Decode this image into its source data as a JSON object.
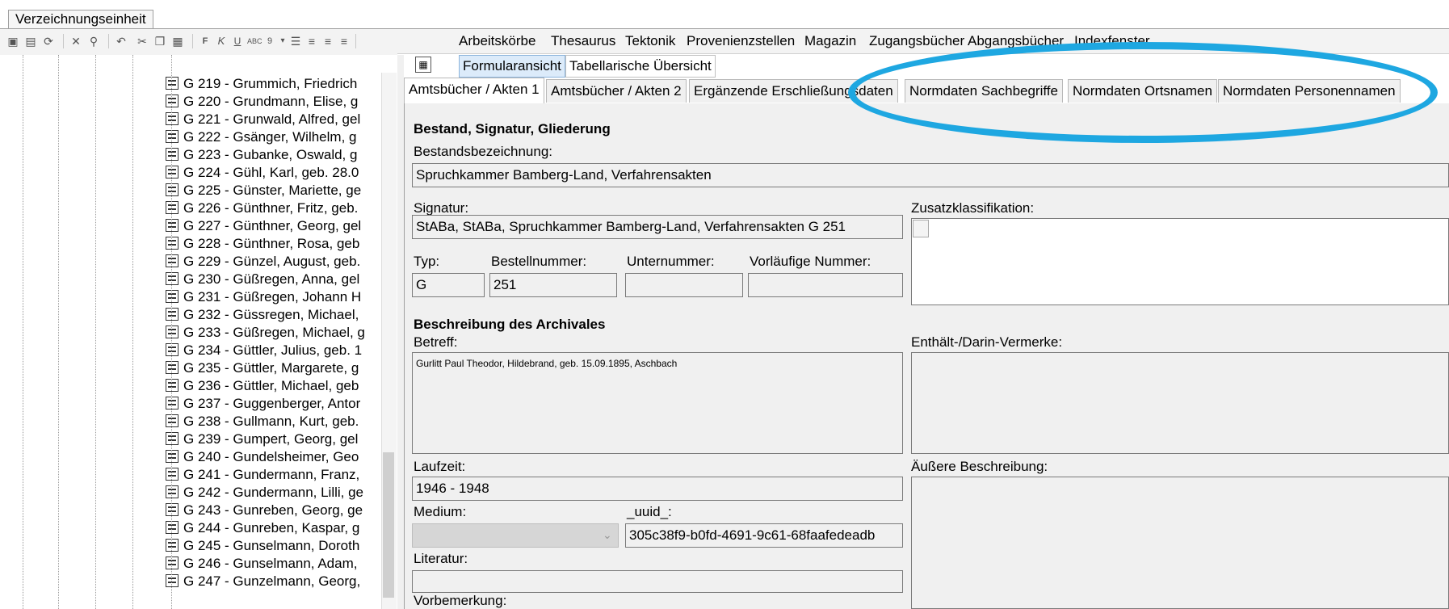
{
  "window_tab": "Verzeichnungseinheit",
  "menu": [
    "Arbeitskörbe",
    "Thesaurus",
    "Tektonik",
    "Provenienzstellen",
    "Magazin",
    "Zugangsbücher",
    "Abgangsbücher",
    "Indexfenster"
  ],
  "view_tabs": [
    "Formularansicht",
    "Tabellarische Übersicht"
  ],
  "form_tabs": [
    "Amtsbücher / Akten 1",
    "Amtsbücher / Akten 2",
    "Ergänzende Erschließungsdaten",
    "Normdaten Sachbegriffe",
    "Normdaten Ortsnamen",
    "Normdaten Personennamen"
  ],
  "tree": [
    "G 219 - Grummich, Friedrich",
    "G 220 - Grundmann, Elise, g",
    "G 221 - Grunwald, Alfred, gel",
    "G 222 - Gsänger, Wilhelm, g",
    "G 223 - Gubanke, Oswald, g",
    "G 224 - Gühl, Karl, geb. 28.0",
    "G 225 - Günster, Mariette, ge",
    "G 226 - Günthner, Fritz, geb.",
    "G 227 - Günthner, Georg, gel",
    "G 228 - Günthner, Rosa, geb",
    "G 229 - Günzel, August, geb.",
    "G 230 - Güßregen, Anna, gel",
    "G 231 - Güßregen, Johann H",
    "G 232 - Güssregen, Michael,",
    "G 233 - Güßregen, Michael, g",
    "G 234 - Güttler, Julius, geb. 1",
    "G 235 - Güttler, Margarete, g",
    "G 236 - Güttler, Michael, geb",
    "G 237 - Guggenberger, Antor",
    "G 238 - Gullmann, Kurt, geb.",
    "G 239 - Gumpert, Georg, gel",
    "G 240 - Gundelsheimer, Geo",
    "G 241 - Gundermann, Franz,",
    "G 242 - Gundermann, Lilli, ge",
    "G 243 - Gunreben, Georg, ge",
    "G 244 - Gunreben, Kaspar, g",
    "G 245 - Gunselmann, Doroth",
    "G 246 - Gunselmann, Adam,",
    "G 247 - Gunzelmann, Georg,"
  ],
  "form": {
    "section1": "Bestand, Signatur, Gliederung",
    "bestand_label": "Bestandsbezeichnung:",
    "bestand_value": "Spruchkammer Bamberg-Land, Verfahrensakten",
    "signatur_label": "Signatur:",
    "signatur_value": "StABa, StABa, Spruchkammer Bamberg-Land, Verfahrensakten G 251",
    "zusatz_label": "Zusatzklassifikation:",
    "typ_label": "Typ:",
    "typ_value": "G",
    "bestellnr_label": "Bestellnummer:",
    "bestellnr_value": "251",
    "unternr_label": "Unternummer:",
    "unternr_value": "",
    "vorl_label": "Vorläufige Nummer:",
    "vorl_value": "",
    "section2": "Beschreibung des Archivales",
    "betreff_label": "Betreff:",
    "betreff_value": "Gurlitt Paul Theodor, Hildebrand, geb. 15.09.1895, Aschbach",
    "enthaelt_label": "Enthält-/Darin-Vermerke:",
    "laufzeit_label": "Laufzeit:",
    "laufzeit_value": "1946 - 1948",
    "aeussere_label": "Äußere Beschreibung:",
    "medium_label": "Medium:",
    "uuid_label": "_uuid_:",
    "uuid_value": "305c38f9-b0fd-4691-9c61-68faafedeadb",
    "literatur_label": "Literatur:",
    "vorbemerkung_label": "Vorbemerkung:"
  },
  "colors": {
    "highlight": "#1ea7e1",
    "form_bg": "#f0f0f0"
  }
}
